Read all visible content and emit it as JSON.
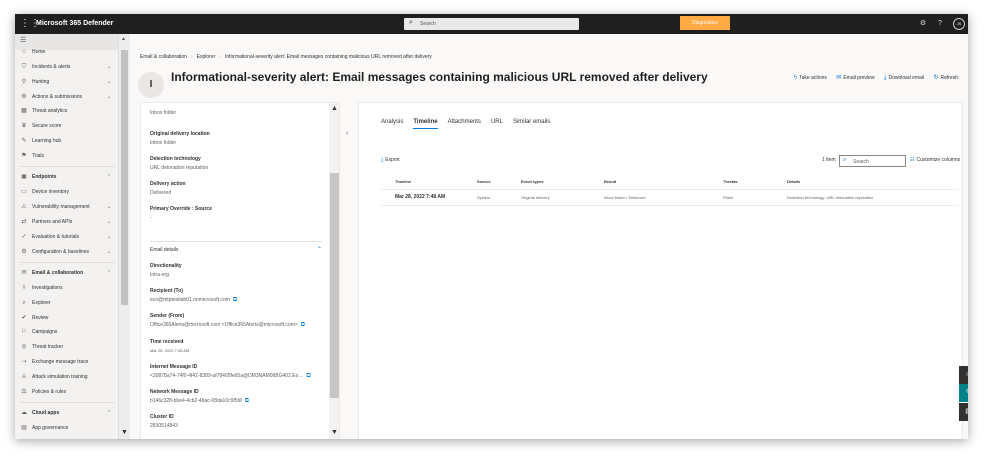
{
  "app": {
    "title": "Microsoft 365 Defender",
    "search_placeholder": "Search",
    "diagnostics_label": "Diagnostics",
    "avatar_initials": "JS"
  },
  "nav": {
    "items": [
      {
        "label": "Home",
        "icon": "home-icon"
      },
      {
        "label": "Incidents & alerts",
        "icon": "shield-icon",
        "chevron": true
      },
      {
        "label": "Hunting",
        "icon": "hunting-icon",
        "chevron": true
      },
      {
        "label": "Actions & submissions",
        "icon": "actions-icon",
        "chevron": true
      },
      {
        "label": "Threat analytics",
        "icon": "analytics-icon"
      },
      {
        "label": "Secure score",
        "icon": "trophy-icon"
      },
      {
        "label": "Learning hub",
        "icon": "learning-icon"
      },
      {
        "label": "Trials",
        "icon": "trials-icon"
      },
      {
        "label": "Endpoints",
        "icon": "endpoints-icon",
        "section": true
      },
      {
        "label": "Device inventory",
        "icon": "device-icon"
      },
      {
        "label": "Vulnerability management",
        "icon": "vulnerability-icon",
        "chevron": true
      },
      {
        "label": "Partners and APIs",
        "icon": "partners-icon",
        "chevron": true
      },
      {
        "label": "Evaluation & tutorials",
        "icon": "evaluation-icon",
        "chevron": true
      },
      {
        "label": "Configuration & baselines",
        "icon": "configuration-icon",
        "chevron": true
      },
      {
        "label": "Email & collaboration",
        "icon": "email-icon",
        "section": true
      },
      {
        "label": "Investigations",
        "icon": "investigations-icon"
      },
      {
        "label": "Explorer",
        "icon": "explorer-icon"
      },
      {
        "label": "Review",
        "icon": "review-icon"
      },
      {
        "label": "Campaigns",
        "icon": "campaigns-icon"
      },
      {
        "label": "Threat tracker",
        "icon": "tracker-icon"
      },
      {
        "label": "Exchange message trace",
        "icon": "trace-icon"
      },
      {
        "label": "Attack simulation training",
        "icon": "simulation-icon"
      },
      {
        "label": "Policies & rules",
        "icon": "policies-icon"
      },
      {
        "label": "Cloud apps",
        "icon": "cloud-icon",
        "section": true
      },
      {
        "label": "App governance",
        "icon": "governance-icon"
      }
    ]
  },
  "breadcrumb": [
    "Email & collaboration",
    "Explorer",
    "Informational-severity alert: Email messages containing malicious URL removed after delivery"
  ],
  "page": {
    "title": "Informational-severity alert: Email messages containing malicious URL removed after delivery",
    "severity_glyph": "I",
    "actions": [
      {
        "label": "Take actions",
        "icon": "lightning-icon"
      },
      {
        "label": "Email preview",
        "icon": "preview-icon"
      },
      {
        "label": "Download email",
        "icon": "download-icon"
      },
      {
        "label": "Refresh",
        "icon": "refresh-icon"
      }
    ]
  },
  "details": {
    "top_value": "Inbox folder",
    "fields": [
      {
        "label": "Original delivery location",
        "value": "Inbox folder"
      },
      {
        "label": "Detection technology",
        "value": "URL detonation reputation"
      },
      {
        "label": "Delivery action",
        "value": "Delivered"
      },
      {
        "label": "Primary Override : Source",
        "value": "-"
      }
    ],
    "section_title": "Email details",
    "email_fields": [
      {
        "label": "Directionality",
        "value": "Intra-org",
        "copy": false
      },
      {
        "label": "Recipient (To)",
        "value": "eco@mtptestlab01.onmicrosoft.com",
        "copy": true
      },
      {
        "label": "Sender (From)",
        "value": "Office365Alerts@microsoft.com <Office365Alerts@microsoft.com>",
        "copy": true
      },
      {
        "label": "Time received",
        "value": "Mar 28, 2022 7:48 AM",
        "copy": false
      },
      {
        "label": "Internet Message ID",
        "value": "<30878a74-74f0-4f42-8389-af78405fe65a@DM3NAM06BG402.Eo…",
        "copy": true
      },
      {
        "label": "Network Message ID",
        "value": "b146c328-bbe4-4cb2-4bac-08da10c9f5bf",
        "copy": true
      },
      {
        "label": "Cluster ID",
        "value": "2830514843",
        "copy": false
      }
    ]
  },
  "tabs": [
    "Analysis",
    "Timeline",
    "Attachments",
    "URL",
    "Similar emails"
  ],
  "active_tab": "Timeline",
  "toolbar": {
    "export_label": "Export",
    "item_count": "1 item",
    "search_placeholder": "Search",
    "customize_label": "Customize columns"
  },
  "table": {
    "columns": [
      "Timeline",
      "Source",
      "Event types",
      "Result",
      "Threats",
      "Details"
    ],
    "rows": [
      [
        "Mar 28, 2022 7:48 AM",
        "System",
        "Original delivery",
        "Inbox folder • Delivered",
        "Phish",
        "Detection technology: URL detonation reputation"
      ]
    ]
  },
  "colors": {
    "accent": "#0078d4",
    "topbar": "#1f1f1f",
    "diagnostics": "#ffaa44",
    "fab_active": "#038387"
  }
}
